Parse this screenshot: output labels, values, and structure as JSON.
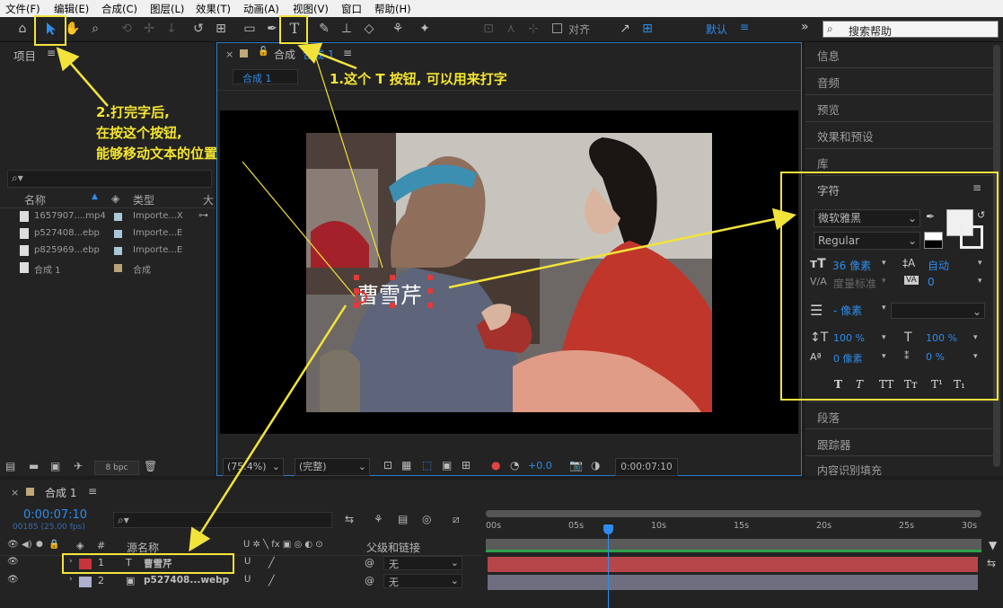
{
  "menu": [
    "文件(F)",
    "编辑(E)",
    "合成(C)",
    "图层(L)",
    "效果(T)",
    "动画(A)",
    "视图(V)",
    "窗口",
    "帮助(H)"
  ],
  "toolbar": {
    "snap_label": "对齐",
    "workspace": "默认",
    "search_placeholder": "搜索帮助"
  },
  "project": {
    "title": "项目",
    "search_placeholder": "",
    "col_name": "名称",
    "col_type": "类型",
    "col_extra": "大",
    "items": [
      {
        "name": "1657907....mp4",
        "type": "Importe...X",
        "color": "#a8c8d8"
      },
      {
        "name": "p527408...ebp",
        "type": "Importe...E",
        "color": "#a8c8d8"
      },
      {
        "name": "p825969...ebp",
        "type": "Importe...E",
        "color": "#a8c8d8"
      },
      {
        "name": "合成 1",
        "type": "合成",
        "color": "#b9a27a"
      }
    ],
    "bpc": "8 bpc"
  },
  "composition": {
    "tab_title": "合成",
    "tab_name": "合成 1",
    "breadcrumb": "合成 1",
    "canvas_text": "曹雪芹",
    "zoom": "(75.4%)",
    "resolution": "(完整)",
    "exposure": "+0.0",
    "timecode": "0:00:07:10"
  },
  "right_panel": {
    "items_top": [
      "信息",
      "音频",
      "预览",
      "效果和预设",
      "库"
    ],
    "character_title": "字符",
    "font_family": "微软雅黑",
    "font_style": "Regular",
    "font_size": "36 像素",
    "leading": "自动",
    "kerning": "度量标准",
    "tracking": "0",
    "stroke": "- 像素",
    "vscale": "100 %",
    "hscale": "100 %",
    "baseline": "0 像素",
    "tsume": "0 %",
    "style_buttons": [
      "T",
      "T",
      "TT",
      "Tт",
      "T¹",
      "T₁"
    ],
    "items_bottom": [
      "段落",
      "跟踪器",
      "内容识别填充"
    ]
  },
  "timeline": {
    "tab": "合成 1",
    "time": "0:00:07:10",
    "frames": "00185 (25.00 fps)",
    "search_placeholder": "",
    "col_source": "源名称",
    "col_parent": "父级和链接",
    "col_num": "#",
    "ruler": [
      "00s",
      "05s",
      "10s",
      "15s",
      "20s",
      "25s",
      "30s"
    ],
    "layers": [
      {
        "num": "1",
        "name": "曹雪芹",
        "parent": "无",
        "label": "#c7353a",
        "bar": "#b7464b"
      },
      {
        "num": "2",
        "name": "p527408...webp",
        "parent": "无",
        "label": "#b0b0d0",
        "bar": "#6e6e80"
      }
    ],
    "playhead_fraction": 0.246
  },
  "annotations": {
    "a1": "1.这个 T 按钮, 可以用来打字",
    "a2_line1": "2.打完字后,",
    "a2_line2": "在按这个按钮,",
    "a2_line3": "能够移动文本的位置"
  }
}
